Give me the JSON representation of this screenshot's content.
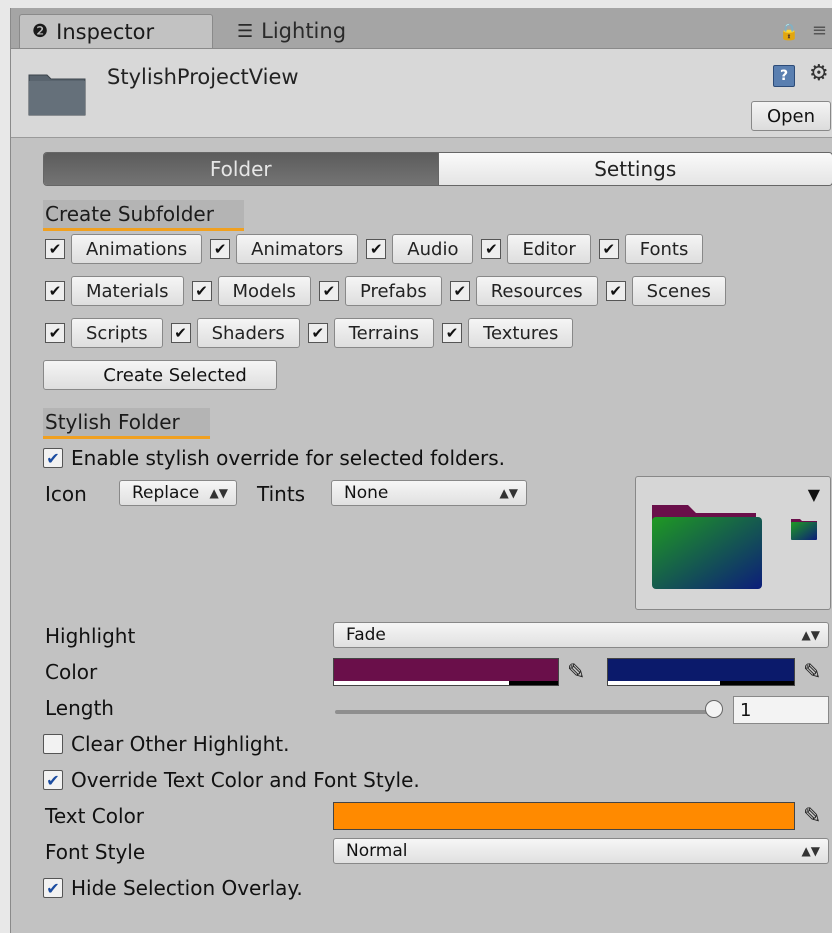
{
  "tabs": [
    {
      "label": "Inspector",
      "icon": "info-icon"
    },
    {
      "label": "Lighting",
      "icon": "sliders-icon"
    }
  ],
  "header": {
    "asset_name": "StylishProjectView",
    "open_label": "Open"
  },
  "toolbar": {
    "tabs": [
      "Folder",
      "Settings"
    ],
    "selected": "Folder"
  },
  "create_subfolder": {
    "section_label": "Create Subfolder",
    "rows": [
      [
        {
          "label": "Animations",
          "checked": true
        },
        {
          "label": "Animators",
          "checked": true
        },
        {
          "label": "Audio",
          "checked": true
        },
        {
          "label": "Editor",
          "checked": true
        },
        {
          "label": "Fonts",
          "checked": true
        }
      ],
      [
        {
          "label": "Materials",
          "checked": true
        },
        {
          "label": "Models",
          "checked": true
        },
        {
          "label": "Prefabs",
          "checked": true
        },
        {
          "label": "Resources",
          "checked": true
        },
        {
          "label": "Scenes",
          "checked": true
        }
      ],
      [
        {
          "label": "Scripts",
          "checked": true
        },
        {
          "label": "Shaders",
          "checked": true
        },
        {
          "label": "Terrains",
          "checked": true
        },
        {
          "label": "Textures",
          "checked": true
        }
      ]
    ],
    "create_button": "Create Selected"
  },
  "stylish_folder": {
    "section_label": "Stylish Folder",
    "enable_label": "Enable stylish override for selected folders.",
    "icon_label": "Icon",
    "icon_value": "Replace",
    "tints_label": "Tints",
    "tints_value": "None",
    "highlight_label": "Highlight",
    "highlight_value": "Fade",
    "color_label": "Color",
    "color_left": "#6a0f4a",
    "color_right": "#0b1a6b",
    "length_label": "Length",
    "length_value": "1",
    "clear_other_label": "Clear Other Highlight.",
    "override_text_label": "Override Text Color and Font Style.",
    "text_color_label": "Text Color",
    "text_color": "#ff8a00",
    "font_style_label": "Font Style",
    "font_style_value": "Normal",
    "hide_selection_label": "Hide Selection Overlay."
  }
}
